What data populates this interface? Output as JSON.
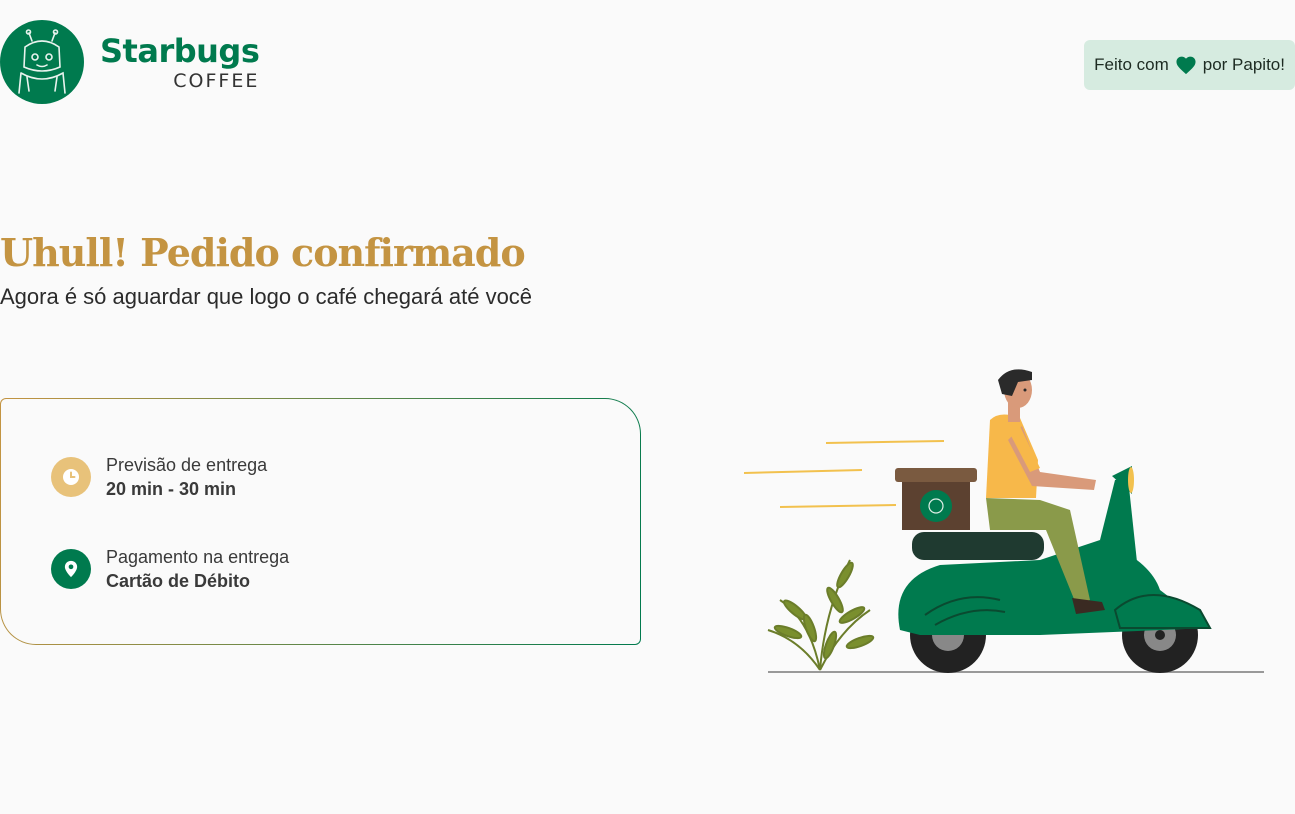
{
  "header": {
    "brand_name": "Starbugs",
    "brand_sub": "COFFEE",
    "made_with": {
      "prefix": "Feito com",
      "suffix": "por Papito!",
      "icon": "heart-icon"
    }
  },
  "confirmation": {
    "title": "Uhull! Pedido confirmado",
    "subtitle": "Agora é só aguardar que logo o café chegará até você"
  },
  "details": {
    "delivery": {
      "label": "Previsão de entrega",
      "value": "20 min - 30 min",
      "icon": "clock-icon"
    },
    "payment": {
      "label": "Pagamento na entrega",
      "value": "Cartão de Débito",
      "icon": "location-pin-icon"
    }
  },
  "colors": {
    "brand_green": "#007a4e",
    "accent_gold": "#c49442",
    "badge_bg": "#d6ebe0",
    "clock_bg": "#e8c27a"
  }
}
